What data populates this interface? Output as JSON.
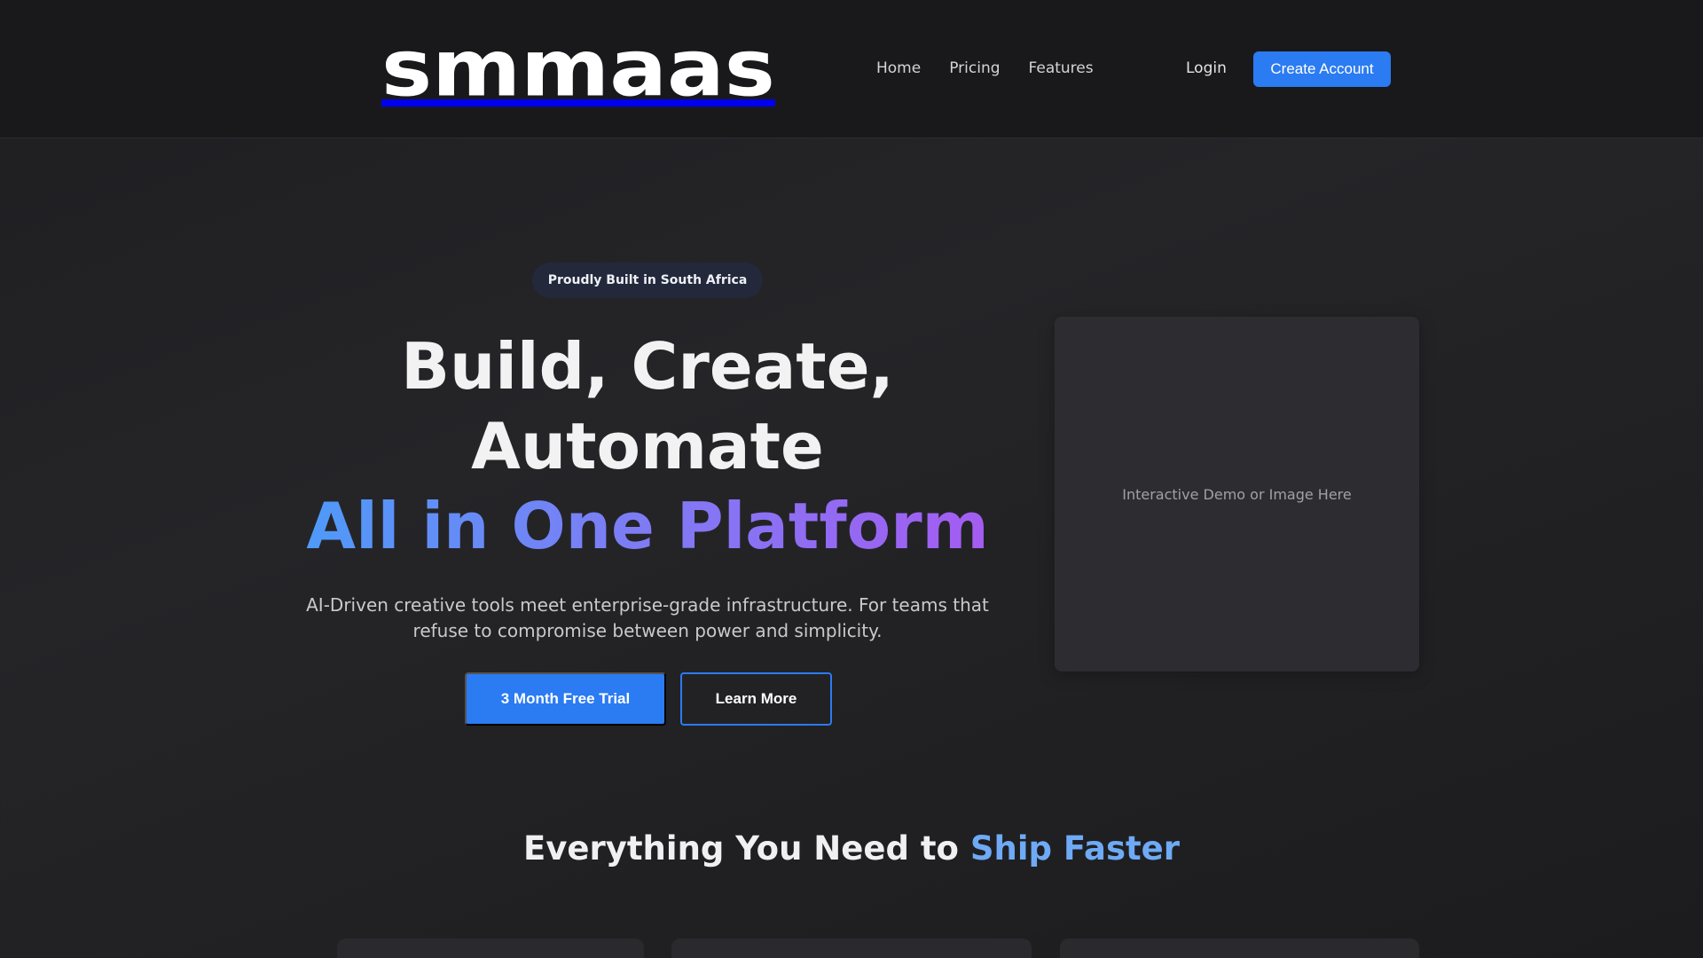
{
  "header": {
    "logo_text": "smmaas",
    "nav": [
      "Home",
      "Pricing",
      "Features"
    ],
    "login_label": "Login",
    "create_account_label": "Create Account"
  },
  "hero": {
    "badge": "Proudly Built in South Africa",
    "headline_line1": "Build, Create,",
    "headline_line2": "Automate",
    "headline_line3": "All in One Platform",
    "subtext": "AI-Driven creative tools meet enterprise-grade infrastructure. For teams that refuse to compromise between power and simplicity.",
    "primary_cta": "3 Month Free Trial",
    "secondary_cta": "Learn More",
    "demo_placeholder": "Interactive Demo or Image Here"
  },
  "features": {
    "title_prefix": "Everything You Need to ",
    "title_accent": "Ship Faster"
  },
  "colors": {
    "accent": "#2b7bf2",
    "background": "#1e1e21",
    "gradient_start": "#4f9af8",
    "gradient_end": "#a45cf1"
  }
}
